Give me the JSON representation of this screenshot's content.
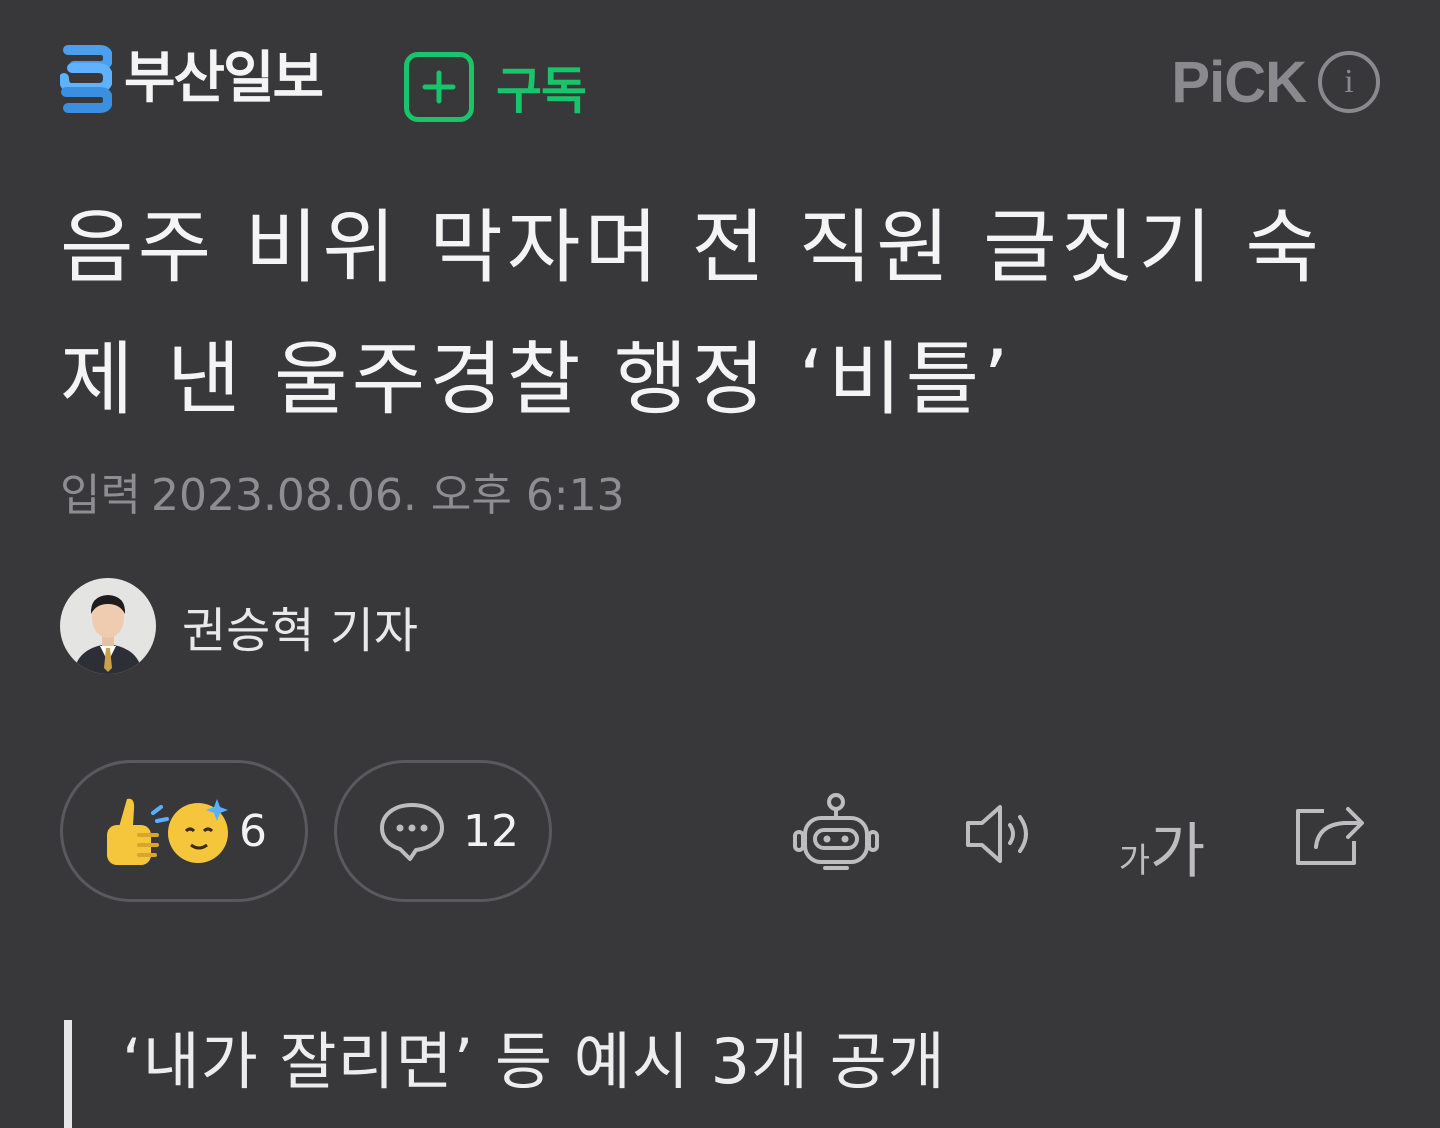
{
  "header": {
    "logo_text": "부산일보",
    "subscribe_label": "구독",
    "pick_label": "PiCK",
    "pick_info_glyph": "i"
  },
  "article": {
    "headline": "음주 비위 막자며 전 직원 글짓기 숙제 낸 울주경찰 행정 ‘비틀’",
    "date_label": "입력",
    "date_value": "2023.08.06. 오후 6:13",
    "reporter": "권승혁 기자",
    "subheadline": "‘내가 잘리면’ 등 예시 3개 공개"
  },
  "actions": {
    "reaction_count": "6",
    "comment_count": "12",
    "font_small": "가",
    "font_large": "가",
    "tools": [
      "robot-summary-icon",
      "speaker-icon",
      "font-size-icon",
      "share-icon"
    ]
  },
  "colors": {
    "background": "#38383b",
    "brand_blue": "#4a9ff0",
    "subscribe_green": "#19c46b",
    "muted_text": "#8e8e92"
  }
}
